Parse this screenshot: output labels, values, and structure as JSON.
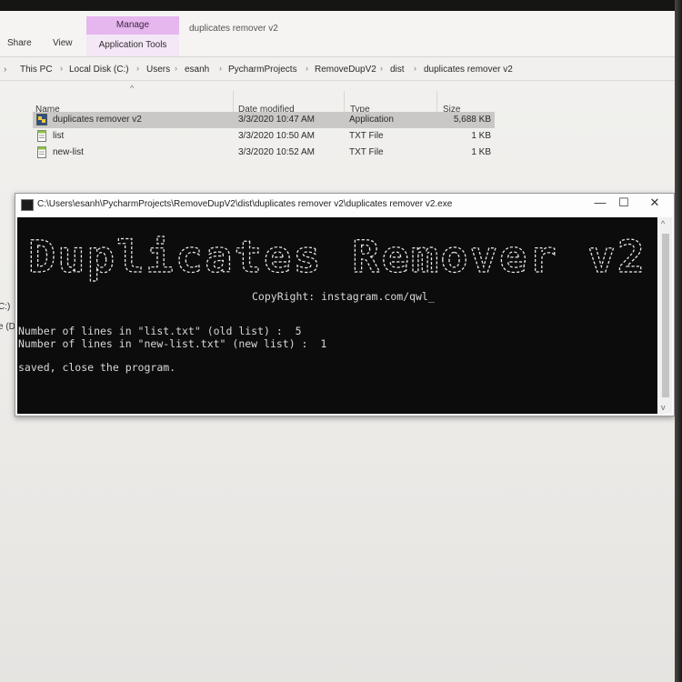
{
  "explorer": {
    "ribbon": {
      "share_tab": "Share",
      "view_tab": "View",
      "manage_tab": "Manage",
      "application_tools": "Application Tools",
      "window_title": "duplicates remover v2"
    },
    "breadcrumbs": [
      "This PC",
      "Local Disk (C:)",
      "Users",
      "esanh",
      "PycharmProjects",
      "RemoveDupV2",
      "dist",
      "duplicates remover v2"
    ],
    "columns": {
      "name": "Name",
      "date_modified": "Date modified",
      "type": "Type",
      "size": "Size"
    },
    "files": [
      {
        "name": "duplicates remover v2",
        "date": "3/3/2020 10:47 AM",
        "type": "Application",
        "size": "5,688 KB",
        "icon": "application-icon",
        "selected": true
      },
      {
        "name": "list",
        "date": "3/3/2020 10:50 AM",
        "type": "TXT File",
        "size": "1 KB",
        "icon": "text-file-icon",
        "selected": false
      },
      {
        "name": "new-list",
        "date": "3/3/2020 10:52 AM",
        "type": "TXT File",
        "size": "1 KB",
        "icon": "text-file-icon",
        "selected": false
      }
    ],
    "left_pane_fragments": [
      "C:)",
      "e (D"
    ]
  },
  "console": {
    "title_path": "C:\\Users\\esanh\\PycharmProjects\\RemoveDupV2\\dist\\duplicates remover v2\\duplicates remover v2.exe",
    "controls": {
      "minimize": "—",
      "maximize": "☐",
      "close": "✕"
    },
    "banner": "Duplicates Remover v2",
    "copyright": "CopyRight: instagram.com/qwl_",
    "line_old": "Number of lines in \"list.txt\" (old list) :  5",
    "line_new": "Number of lines in \"new-list.txt\" (new list) :  1",
    "status": "saved, close the program."
  },
  "colors": {
    "manage_accent": "#e6b6ee",
    "console_bg": "#0c0c0c",
    "console_text": "#d8d8d8"
  }
}
